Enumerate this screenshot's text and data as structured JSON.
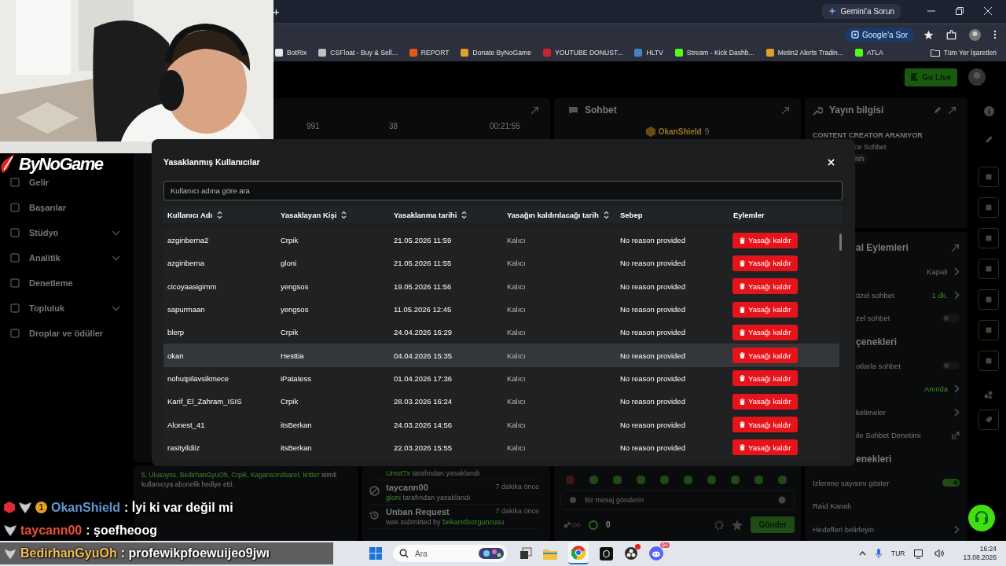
{
  "browser": {
    "new_tab": "+",
    "gemini_button": "Gemini'a Sorun",
    "lens_button": "Google'a Sor",
    "bookmarks": [
      {
        "label": "BotRix",
        "color": "#e6e6e6"
      },
      {
        "label": "CSFloat - Buy & Sell...",
        "color": "#bfbfbf"
      },
      {
        "label": "REPORT",
        "color": "#e05a1a"
      },
      {
        "label": "Donate ByNoGame",
        "color": "#e0a030"
      },
      {
        "label": "YOUTUBE DONUST...",
        "color": "#d02030"
      },
      {
        "label": "HLTV",
        "color": "#4a7fc0"
      },
      {
        "label": "Stream - Kick Dashb...",
        "color": "#53fc18"
      },
      {
        "label": "Metin2 Alerts Tradin...",
        "color": "#e0a030"
      },
      {
        "label": "ATLA",
        "color": "#53fc18"
      }
    ],
    "all_bookmarks": "Tüm Yer İşaretleri"
  },
  "dashboard": {
    "go_live": "Go Live",
    "sidebar": [
      {
        "label": "Gelir",
        "expandable": false
      },
      {
        "label": "Başarılar",
        "expandable": false
      },
      {
        "label": "Stüdyo",
        "expandable": true
      },
      {
        "label": "Analitik",
        "expandable": true
      },
      {
        "label": "Denetleme",
        "expandable": false
      },
      {
        "label": "Topluluk",
        "expandable": true
      },
      {
        "label": "Droplar ve ödüller",
        "expandable": false
      }
    ],
    "stats": [
      "991",
      "38",
      "00:21:55"
    ],
    "gift_notice": {
      "names": "5, Ulusoyss, BedirhanGyuOh, Crpik, Kagansorulsaret, kritter",
      "text": "isimli kullanıcıya abonelik hediye etti."
    },
    "activity": [
      {
        "kind": "ban",
        "actor": "Umut7x",
        "action": "tarafından yasaklandı"
      },
      {
        "kind": "ban",
        "title": "taycann00",
        "time": "7 dakika önce",
        "actor": "gloni",
        "action": "tarafından yasaklandı"
      },
      {
        "kind": "unban_request",
        "title": "Unban Request",
        "time": "7 dakika önce",
        "action": "was submitted by",
        "actor": "bekaretbozguncusu"
      }
    ],
    "chat_panel": {
      "title": "Sohbet",
      "pinned_user": "OkanShield",
      "pinned_count": "9",
      "input_placeholder": "Bir mesaj gönderin",
      "points": "0",
      "send_button": "Gönder"
    },
    "stream_info": {
      "title": "Yayın bilgisi",
      "stream_title": "CONTENT CREATOR ARANIYOR",
      "category": "ce Sohbet",
      "tag": "ish"
    },
    "mod_panel": {
      "title": "al Eylemleri",
      "rows": [
        {
          "kind": "value",
          "value": "Kapalı",
          "accent": false
        },
        {
          "kind": "value",
          "label": "özel sohbet",
          "value": "1 dk.",
          "accent": true
        },
        {
          "kind": "toggle",
          "label": "zel sohbet",
          "on": false
        }
      ]
    },
    "chat_options": {
      "title": "çenekleri",
      "rows": [
        {
          "kind": "toggle",
          "label": "otlarla sohbet",
          "on": false
        },
        {
          "kind": "value",
          "value": "Anında",
          "accent": true
        },
        {
          "kind": "nav",
          "label": "kelimeler"
        },
        {
          "kind": "external",
          "label": "ile Sohbet Denetimi"
        }
      ]
    },
    "view_options": {
      "title": "enekleri",
      "rows": [
        {
          "kind": "toggle",
          "label": "İzlenme sayısını göster",
          "on": true
        },
        {
          "kind": "plain",
          "label": "Raid Kanalı"
        },
        {
          "kind": "nav",
          "label": "Hedefleri belirleyin"
        }
      ]
    }
  },
  "modal": {
    "title": "Yasaklanmış Kullanıcılar",
    "search_placeholder": "Kullanıcı adına göre ara",
    "columns": [
      {
        "label": "Kullanıcı Adı",
        "sortable": true
      },
      {
        "label": "Yasaklayan Kişi",
        "sortable": true
      },
      {
        "label": "Yasaklanma tarihi",
        "sortable": true
      },
      {
        "label": "Yasağın kaldırılacağı tarih",
        "sortable": true
      },
      {
        "label": "Sebep",
        "sortable": false
      },
      {
        "label": "Eylemler",
        "sortable": false
      }
    ],
    "rows": [
      {
        "user": "azginberna2",
        "by": "Crpik",
        "date": "21.05.2026 11:59",
        "until": "Kalıcı",
        "reason": "No reason provided",
        "action": "Yasağı kaldır",
        "highlighted": false
      },
      {
        "user": "azginberna",
        "by": "gloni",
        "date": "21.05.2026 11:55",
        "until": "Kalıcı",
        "reason": "No reason provided",
        "action": "Yasağı kaldır",
        "highlighted": false
      },
      {
        "user": "cicoyaasigimm",
        "by": "yengsos",
        "date": "19.05.2026 11:56",
        "until": "Kalıcı",
        "reason": "No reason provided",
        "action": "Yasağı kaldır",
        "highlighted": false
      },
      {
        "user": "sapurmaan",
        "by": "yengsos",
        "date": "11.05.2026 12:45",
        "until": "Kalıcı",
        "reason": "No reason provided",
        "action": "Yasağı kaldır",
        "highlighted": false
      },
      {
        "user": "blerp",
        "by": "Crpik",
        "date": "24.04.2026 16:29",
        "until": "Kalıcı",
        "reason": "No reason provided",
        "action": "Yasağı kaldır",
        "highlighted": false
      },
      {
        "user": "okan",
        "by": "Hesttia",
        "date": "04.04.2026 15:35",
        "until": "Kalıcı",
        "reason": "No reason provided",
        "action": "Yasağı kaldır",
        "highlighted": true
      },
      {
        "user": "nohutpilavsikmece",
        "by": "iPatatess",
        "date": "01.04.2026 17:36",
        "until": "Kalıcı",
        "reason": "No reason provided",
        "action": "Yasağı kaldır",
        "highlighted": false
      },
      {
        "user": "Karif_El_Zahram_ISIS",
        "by": "Crpik",
        "date": "28.03.2026 16:24",
        "until": "Kalıcı",
        "reason": "No reason provided",
        "action": "Yasağı kaldır",
        "highlighted": false
      },
      {
        "user": "Alonest_41",
        "by": "itsBerkan",
        "date": "24.03.2026 14:56",
        "until": "Kalıcı",
        "reason": "No reason provided",
        "action": "Yasağı kaldır",
        "highlighted": false
      },
      {
        "user": "rasityildiiz",
        "by": "itsBerkan",
        "date": "22.03.2026 15:55",
        "until": "Kalıcı",
        "reason": "No reason provided",
        "action": "Yasağı kaldır",
        "highlighted": false
      }
    ]
  },
  "overlay": {
    "logo": "ByNoGame",
    "chat": [
      {
        "user": "OkanShield",
        "color": "#5f97d3",
        "message": ": İyi ki var değil mi",
        "badges": [
          {
            "kind": "gem"
          },
          {
            "kind": "wings"
          },
          {
            "kind": "number",
            "text": "1"
          }
        ],
        "highlighted": false
      },
      {
        "user": "taycann00",
        "color": "#e8503a",
        "message": ": şoefheoog",
        "badges": [
          {
            "kind": "wings"
          }
        ],
        "highlighted": false
      },
      {
        "user": "BedirhanGyuOh",
        "color": "#f5bf55",
        "message": ": profewikpfoewuijeo9jwı",
        "badges": [
          {
            "kind": "wings"
          }
        ],
        "highlighted": true
      }
    ]
  },
  "taskbar": {
    "search_placeholder": "Ara",
    "discord_badge": "9+",
    "language": "TUR",
    "time": "16:24",
    "date": "13.08.2026"
  }
}
